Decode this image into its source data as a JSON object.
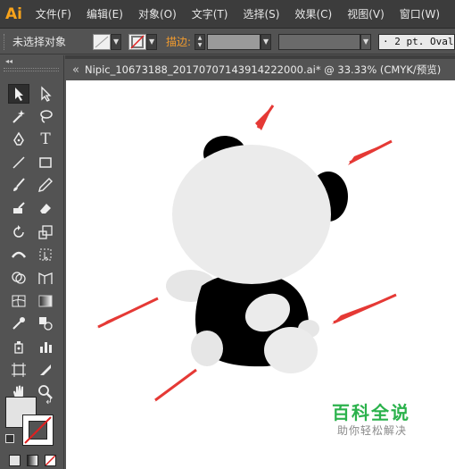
{
  "app": {
    "logo": "Ai"
  },
  "menu": {
    "items": [
      "文件(F)",
      "编辑(E)",
      "对象(O)",
      "文字(T)",
      "选择(S)",
      "效果(C)",
      "视图(V)",
      "窗口(W)"
    ]
  },
  "control_bar": {
    "selection_status": "未选择对象",
    "stroke_label": "描边:",
    "brush_value": "· 2 pt. Oval"
  },
  "document": {
    "tab_title": "Nipic_10673188_20170707143914222000.ai* @ 33.33% (CMYK/预览)",
    "close_glyph": "«"
  },
  "watermark": {
    "title": "百科全说",
    "subtitle": "助你轻松解决"
  },
  "colors": {
    "accent_orange": "#f39c2e",
    "panda_white": "#ebebeb",
    "panda_black": "#000000",
    "arrow_red": "#e53935",
    "watermark_green": "#2bb24c"
  },
  "icons": [
    "selection-arrow-icon",
    "direct-selection-icon",
    "magic-wand-icon",
    "lasso-icon",
    "pen-icon",
    "type-icon",
    "line-segment-icon",
    "rectangle-icon",
    "paintbrush-icon",
    "pencil-icon",
    "blob-brush-icon",
    "eraser-icon",
    "rotate-icon",
    "scale-icon",
    "width-icon",
    "free-transform-icon",
    "shape-builder-icon",
    "perspective-grid-icon",
    "mesh-icon",
    "gradient-icon",
    "eyedropper-icon",
    "blend-icon",
    "symbol-sprayer-icon",
    "column-graph-icon",
    "artboard-icon",
    "slice-icon",
    "hand-icon",
    "zoom-icon"
  ]
}
